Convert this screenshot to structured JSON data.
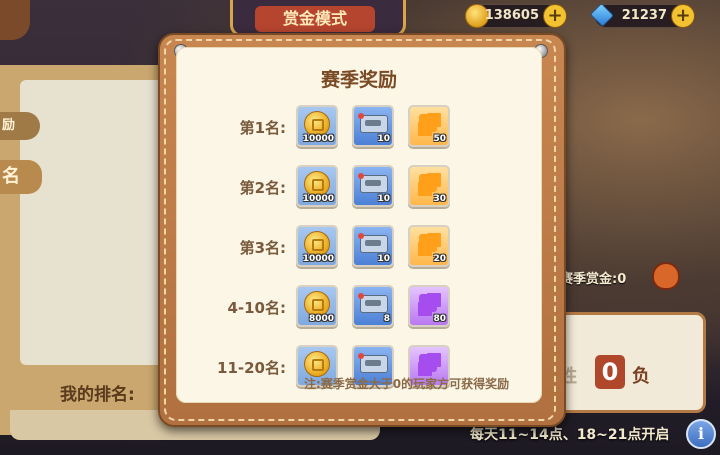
{
  "header": {
    "mode_title": "赏金模式",
    "coins": "138605",
    "gems": "21237",
    "plus": "+"
  },
  "left_panel": {
    "tab_top": "励",
    "tab_mid": "名",
    "my_rank_label": "我的排名:"
  },
  "right_panel": {
    "season_bounty_label": "赛季赏金:0",
    "win_char": "胜",
    "loss_count": "0",
    "loss_char": "负"
  },
  "footer": {
    "open_hours": "每天11~14点、18~21点开启",
    "info_symbol": "i"
  },
  "modal": {
    "title": "赛季奖励",
    "note": "注:赛季赏金大于0的玩家方可获得奖励",
    "rows": [
      {
        "label": "第1名:",
        "items": [
          {
            "kind": "coin",
            "icon": "gold-coin-icon",
            "qty": "10000"
          },
          {
            "kind": "ticket",
            "icon": "ticket-icon",
            "qty": "10"
          },
          {
            "kind": "puzzle-orange",
            "icon": "orange-puzzle-icon",
            "qty": "50"
          }
        ]
      },
      {
        "label": "第2名:",
        "items": [
          {
            "kind": "coin",
            "icon": "gold-coin-icon",
            "qty": "10000"
          },
          {
            "kind": "ticket",
            "icon": "ticket-icon",
            "qty": "10"
          },
          {
            "kind": "puzzle-orange",
            "icon": "orange-puzzle-icon",
            "qty": "30"
          }
        ]
      },
      {
        "label": "第3名:",
        "items": [
          {
            "kind": "coin",
            "icon": "gold-coin-icon",
            "qty": "10000"
          },
          {
            "kind": "ticket",
            "icon": "ticket-icon",
            "qty": "10"
          },
          {
            "kind": "puzzle-orange",
            "icon": "orange-puzzle-icon",
            "qty": "20"
          }
        ]
      },
      {
        "label": "4-10名:",
        "items": [
          {
            "kind": "coin",
            "icon": "gold-coin-icon",
            "qty": "8000"
          },
          {
            "kind": "ticket",
            "icon": "ticket-icon",
            "qty": "8"
          },
          {
            "kind": "puzzle-purple",
            "icon": "purple-puzzle-icon",
            "qty": "80"
          }
        ]
      },
      {
        "label": "11-20名:",
        "items": [
          {
            "kind": "coin",
            "icon": "gold-coin-icon",
            "qty": ""
          },
          {
            "kind": "ticket",
            "icon": "ticket-icon",
            "qty": ""
          },
          {
            "kind": "puzzle-purple",
            "icon": "purple-puzzle-icon",
            "qty": ""
          }
        ]
      }
    ]
  },
  "colors": {
    "frame": "#b8773f",
    "paper": "#fbf6e6",
    "title": "#7a4a24",
    "accent_red": "#b1472a"
  }
}
